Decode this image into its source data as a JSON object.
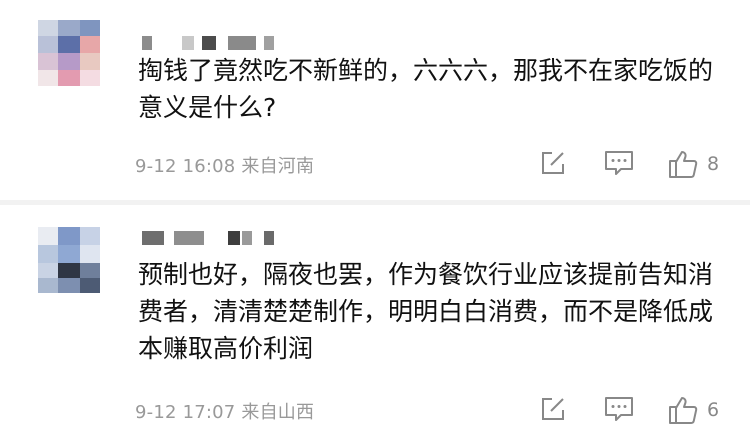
{
  "comments": [
    {
      "text": "掏钱了竟然吃不新鲜的，六六六，那我不在家吃饭的意义是什么?",
      "meta": "9-12 16:08 来自河南",
      "likes": "8",
      "icons": [
        "avatar-blurred",
        "edit-icon",
        "comment-icon",
        "thumbs-up-icon"
      ]
    },
    {
      "text": "预制也好，隔夜也罢，作为餐饮行业应该提前告知消费者，清清楚楚制作，明明白白消费，而不是降低成本赚取高价利润",
      "meta": "9-12 17:07 来自山西",
      "likes": "6",
      "icons": [
        "avatar-blurred",
        "edit-icon",
        "comment-icon",
        "thumbs-up-icon"
      ]
    }
  ]
}
